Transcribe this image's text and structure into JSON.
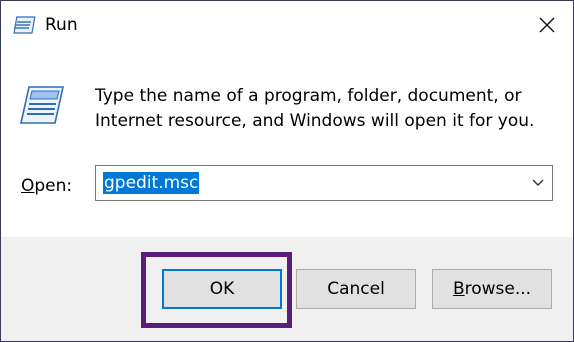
{
  "window": {
    "title": "Run",
    "close_icon": "close-icon"
  },
  "content": {
    "description": "Type the name of a program, folder, document, or Internet resource, and Windows will open it for you.",
    "open_label_accel": "O",
    "open_label_rest": "pen:",
    "input_value": "gpedit.msc"
  },
  "buttons": {
    "ok": "OK",
    "cancel": "Cancel",
    "browse_accel": "B",
    "browse_rest": "rowse..."
  },
  "colors": {
    "selection": "#0078d7",
    "highlight_box": "#5a1d7a",
    "footer_bg": "#f0f0f0"
  }
}
